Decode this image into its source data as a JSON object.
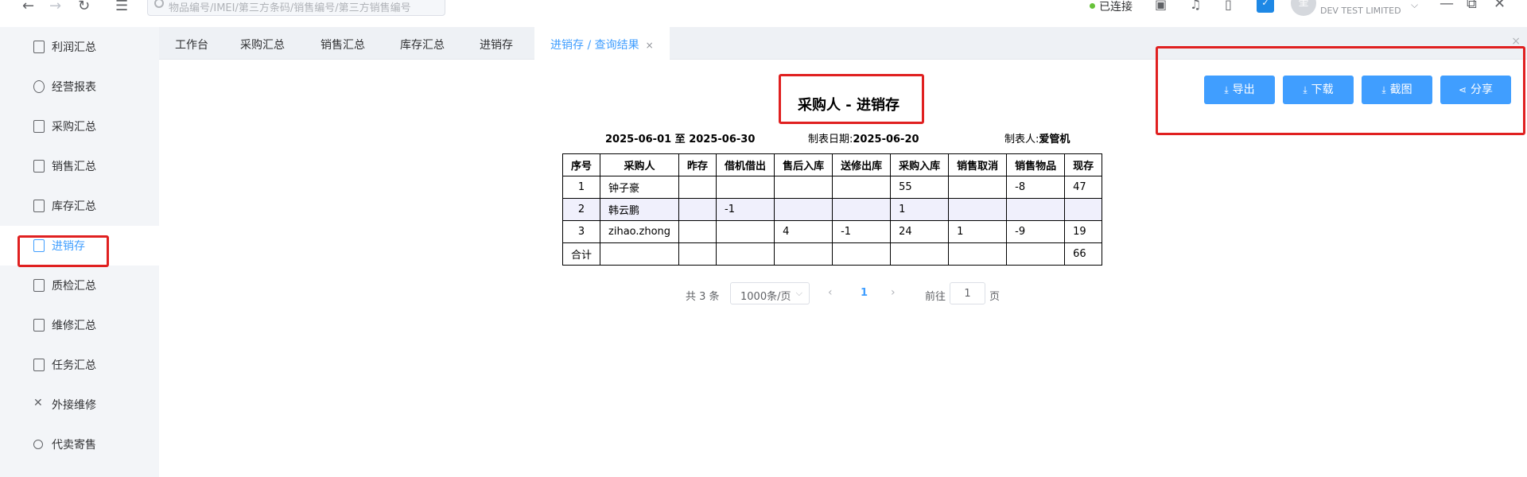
{
  "topbar": {
    "search_placeholder": "物品编号/IMEI/第三方条码/销售编号/第三方销售编号",
    "status_text": "已连接",
    "avatar_text": "奎",
    "company": "DEV TEST LIMITED",
    "back_icon": "←",
    "forward_icon": "→",
    "refresh_icon": "↻",
    "menu_icon": "☰",
    "chevron_icon": "⌵",
    "min_icon": "—",
    "max_icon": "⧉",
    "close_icon": "✕",
    "check_icon": "✓"
  },
  "sidebar": {
    "items": [
      {
        "label": "利润汇总"
      },
      {
        "label": "经营报表"
      },
      {
        "label": "采购汇总"
      },
      {
        "label": "销售汇总"
      },
      {
        "label": "库存汇总"
      },
      {
        "label": "进销存"
      },
      {
        "label": "质检汇总"
      },
      {
        "label": "维修汇总"
      },
      {
        "label": "任务汇总"
      },
      {
        "label": "外接维修"
      },
      {
        "label": "代卖寄售"
      }
    ],
    "active_index": 5
  },
  "tabs": {
    "items": [
      "工作台",
      "采购汇总",
      "销售汇总",
      "库存汇总",
      "进销存"
    ],
    "active": "进销存 / 查询结果",
    "close_icon": "×"
  },
  "report": {
    "title": "采购人 - 进销存",
    "date_range": "2025-06-01 至 2025-06-30",
    "made_date_label": "制表日期:",
    "made_date": "2025-06-20",
    "maker_label": "制表人:",
    "maker": "爱管机"
  },
  "table": {
    "headers": [
      "序号",
      "采购人",
      "昨存",
      "借机借出",
      "售后入库",
      "送修出库",
      "采购入库",
      "销售取消",
      "销售物品",
      "现存"
    ],
    "rows": [
      [
        "1",
        "钟子豪",
        "",
        "",
        "",
        "",
        "55",
        "",
        "-8",
        "47"
      ],
      [
        "2",
        "韩云鹏",
        "",
        "-1",
        "",
        "",
        "1",
        "",
        "",
        ""
      ],
      [
        "3",
        "zihao.zhong",
        "",
        "",
        "4",
        "-1",
        "24",
        "1",
        "-9",
        "19"
      ],
      [
        "合计",
        "",
        "",
        "",
        "",
        "",
        "",
        "",
        "",
        "66"
      ]
    ]
  },
  "pagination": {
    "total": "共 3 条",
    "page_size": "1000条/页",
    "current": "1",
    "goto_label": "前往",
    "goto_value": "1",
    "page_label": "页",
    "prev_icon": "‹",
    "next_icon": "›",
    "size_arrow": "⌵"
  },
  "actions": {
    "export": "导出",
    "download": "下载",
    "screenshot": "截图",
    "share": "分享",
    "download_icon": "⤓",
    "share_icon": "⋖"
  },
  "colors": {
    "accent": "#409eff",
    "highlight": "#e02020",
    "status_ok": "#67c23a"
  }
}
